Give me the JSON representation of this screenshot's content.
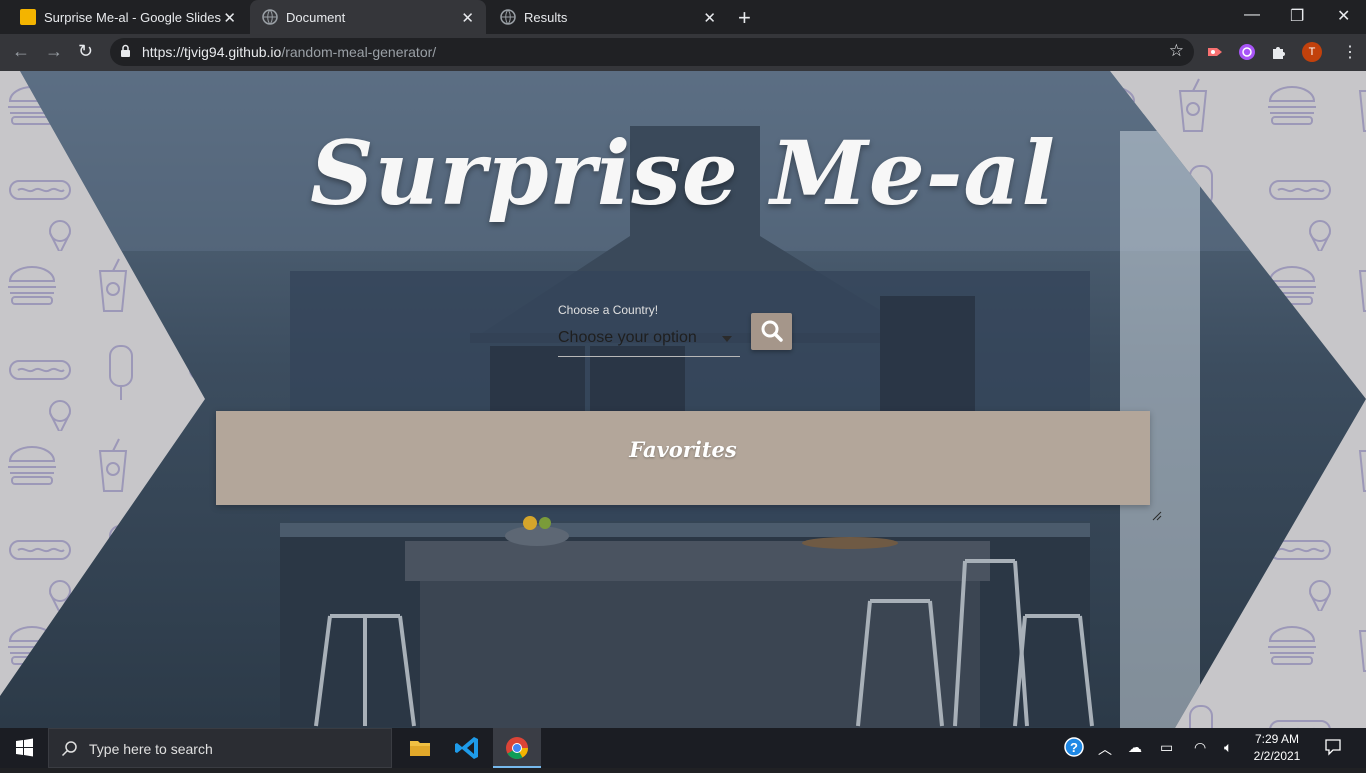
{
  "browser": {
    "tabs": [
      {
        "title": "Surprise Me-al - Google Slides",
        "active": false
      },
      {
        "title": "Document",
        "active": true
      },
      {
        "title": "Results",
        "active": false
      }
    ],
    "new_tab": "+",
    "url_host": "https://tjvig94.github.io",
    "url_path": "/random-meal-generator/",
    "profile_initial": "T",
    "window_controls": {
      "minimize": "—",
      "restore": "❐",
      "close": "✕"
    }
  },
  "page": {
    "title": "Surprise Me-al",
    "select": {
      "label": "Choose a Country!",
      "value": "Choose your option"
    },
    "favorites_title": "Favorites",
    "colors": {
      "accent": "#a5968a",
      "favorites_bg": "#b3a69a",
      "side_bg": "#c7c6c9",
      "pattern": "#9c98b8"
    }
  },
  "taskbar": {
    "search_placeholder": "Type here to search",
    "time": "7:29 AM",
    "date": "2/2/2021"
  }
}
